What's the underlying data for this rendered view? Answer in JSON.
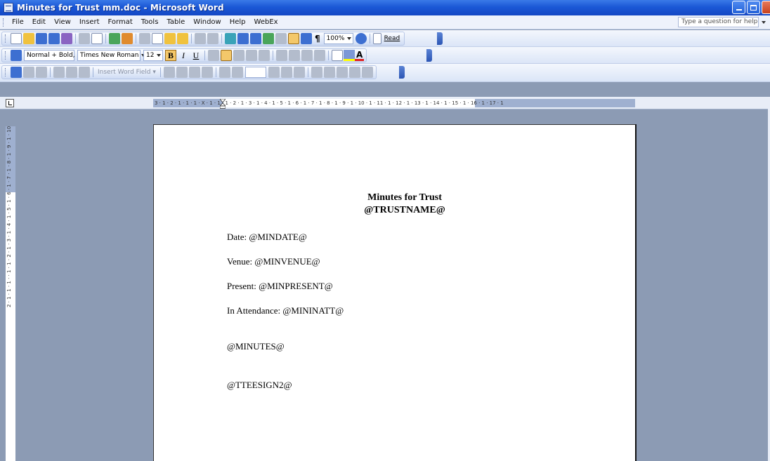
{
  "window": {
    "title": "Minutes for Trust mm.doc - Microsoft Word"
  },
  "menubar": {
    "items": [
      "File",
      "Edit",
      "View",
      "Insert",
      "Format",
      "Tools",
      "Table",
      "Window",
      "Help",
      "WebEx"
    ],
    "help_placeholder": "Type a question for help"
  },
  "standard_toolbar": {
    "zoom": "100%",
    "read_label": "Read"
  },
  "formatting_toolbar": {
    "style": "Normal + Bold,",
    "font": "Times New Roman",
    "size": "12",
    "bold": "B",
    "italic": "I",
    "underline": "U",
    "font_color_glyph": "A"
  },
  "mail_merge_toolbar": {
    "insert_word_field": "Insert Word Field"
  },
  "ruler": {
    "horizontal": "3 · 1 · 2 · 1 · 1 · 1 · X · 1 · 1 · 1 · 2 · 1 · 3 · 1 · 4 · 1 · 5 · 1 · 6 · 1 · 7 · 1 · 8 · 1 · 9 · 1 · 10 · 1 · 11 · 1 · 12 · 1 · 13 · 1 · 14 · 1 · 15 · 1 · 16 · 1 · 17 · 1",
    "vertical": "2 · 1 · 1 · 1 · · 1 · 1 · 2 · 1 · 3 · 1 · 4 · 1 · 5 · 1 · 6 · 1 · 7 · 1 · 8 · 1 · 9 · 1 · 10"
  },
  "document": {
    "heading_line1": "Minutes for Trust",
    "heading_line2": "@TRUSTNAME@",
    "date_line": "Date: @MINDATE@",
    "venue_line": "Venue: @MINVENUE@",
    "present_line": "Present: @MINPRESENT@",
    "attendance_line": "In Attendance: @MININATT@",
    "minutes_field": "@MINUTES@",
    "sign_field": "@TTEESIGN2@"
  }
}
